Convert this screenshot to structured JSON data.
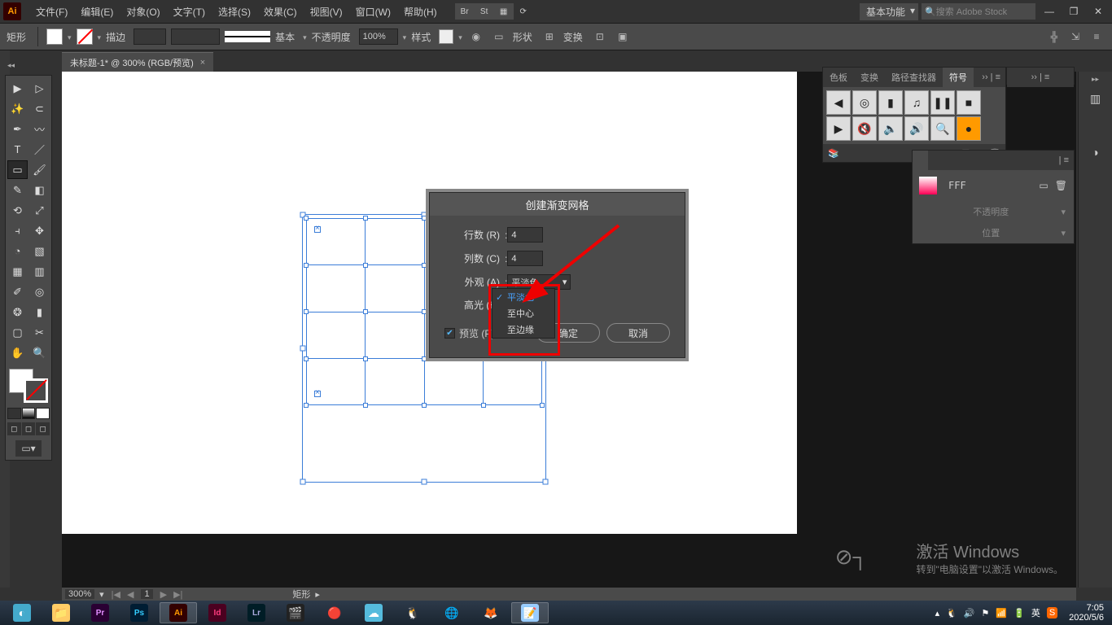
{
  "menus": {
    "file": "文件(F)",
    "edit": "编辑(E)",
    "object": "对象(O)",
    "type": "文字(T)",
    "select": "选择(S)",
    "effect": "效果(C)",
    "view": "视图(V)",
    "window": "窗口(W)",
    "help": "帮助(H)"
  },
  "titlebar": {
    "br": "Br",
    "st": "St",
    "workspace": "基本功能",
    "stock_placeholder": "搜索 Adobe Stock"
  },
  "controlbar": {
    "shape": "矩形",
    "stroke": "描边",
    "stroke_pt": "",
    "dash": "",
    "profile": "基本",
    "opacity": "不透明度",
    "opacity_val": "100%",
    "style": "样式",
    "shape_lbl": "形状",
    "transform": "变换"
  },
  "doctab": {
    "title": "未标题-1* @ 300% (RGB/预览)",
    "close": "×"
  },
  "dialog": {
    "title": "创建渐变网格",
    "rows": "行数 (R)",
    "rows_val": "4",
    "cols": "列数 (C)",
    "cols_val": "4",
    "appearance": "外观 (A)",
    "appearance_val": "平淡色",
    "highlight": "高光 (H)",
    "preview": "预览 (P)",
    "ok": "确定",
    "cancel": "取消",
    "options": {
      "flat": "平淡色",
      "center": "至中心",
      "edge": "至边缘"
    }
  },
  "panels": {
    "sym_tabs": {
      "swatch": "色板",
      "trans": "变换",
      "pathfind": "路径查找器",
      "symbols": "符号"
    },
    "prop_tabs": {
      "a": "",
      "fff": "FFF"
    },
    "prop_rows": {
      "opacity": "不透明度",
      "pos": "位置"
    }
  },
  "statusbar": {
    "zoom": "300%",
    "page": "1",
    "tool": "矩形"
  },
  "watermark": {
    "t1": "激活 Windows",
    "t2": "转到\"电脑设置\"以激活 Windows。"
  },
  "tray": {
    "ime": "英",
    "time": "7:05",
    "date": "2020/5/6"
  }
}
